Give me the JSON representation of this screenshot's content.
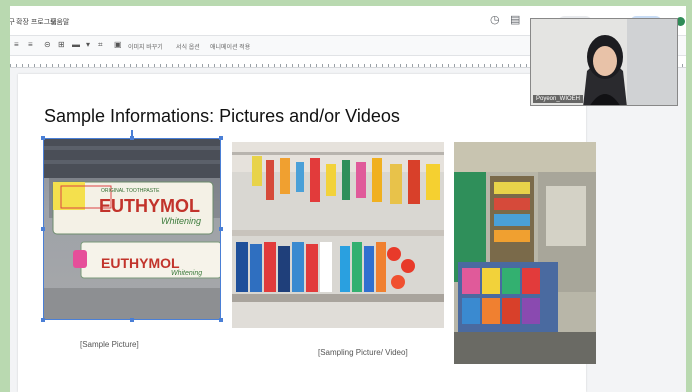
{
  "menubar": {
    "items": [
      "도구",
      "확장 프로그램",
      "도움말"
    ]
  },
  "toolbar": {
    "items": [
      "이미지 바꾸기",
      "서식 옵션",
      "애니메이션 적용"
    ]
  },
  "slide": {
    "title": "Sample Informations: Pictures and/or Videos",
    "captions": {
      "sample": "[Sample Picture]",
      "sampling": "[Sampling Picture/ Video]"
    },
    "product_text": {
      "brand": "EUTHYMOL",
      "sub": "Whitening",
      "label": "ORIGINAL TOOTHPASTE"
    }
  },
  "video": {
    "participant_name": "Poyeon_WIOEH"
  },
  "colors": {
    "background": "#b9d9b0",
    "selection": "#4a7fd6"
  }
}
